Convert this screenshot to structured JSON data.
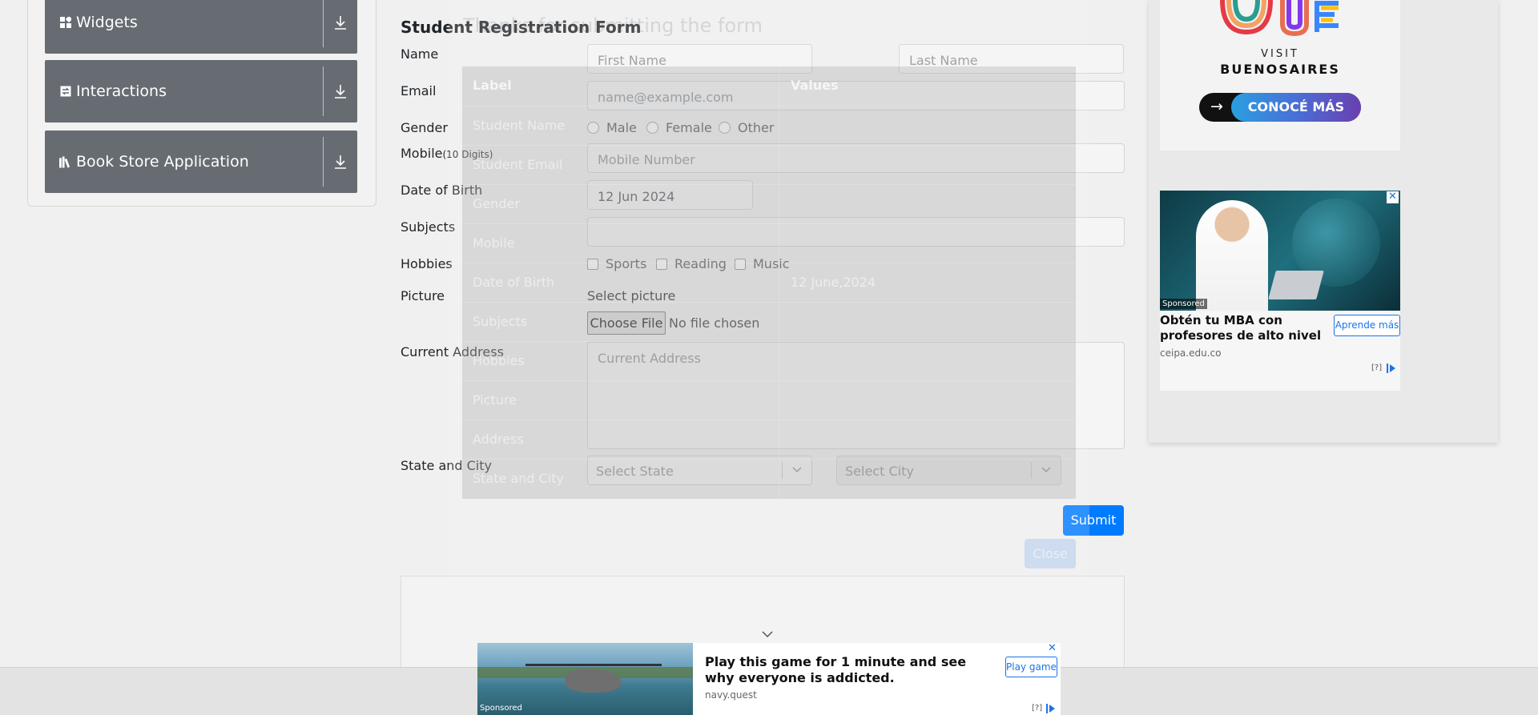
{
  "sidebar": {
    "groups": [
      {
        "label": "Widgets",
        "icon": "widgets-icon"
      },
      {
        "label": "Interactions",
        "icon": "interactions-icon"
      },
      {
        "label": "Book Store Application",
        "icon": "book-icon"
      }
    ]
  },
  "form": {
    "title": "Student Registration Form",
    "labels": {
      "name": "Name",
      "email": "Email",
      "gender": "Gender",
      "mobile": "Mobile",
      "mobile_hint": "(10 Digits)",
      "dob": "Date of Birth",
      "subjects": "Subjects",
      "hobbies": "Hobbies",
      "picture": "Picture",
      "address": "Current Address",
      "state_city": "State and City"
    },
    "first_name_placeholder": "First Name",
    "last_name_placeholder": "Last Name",
    "email_placeholder": "name@example.com",
    "gender_options": [
      "Male",
      "Female",
      "Other"
    ],
    "mobile_placeholder": "Mobile Number",
    "dob_value": "12 Jun 2024",
    "subjects_value": "",
    "hobbies_options": [
      "Sports",
      "Reading",
      "Music"
    ],
    "picture_label": "Select picture",
    "choose_file": "Choose File",
    "no_file": "No file chosen",
    "address_placeholder": "Current Address",
    "state_placeholder": "Select State",
    "city_placeholder": "Select City",
    "submit": "Submit"
  },
  "modal": {
    "title": "Thanks for submitting the form",
    "header": {
      "label": "Label",
      "values": "Values"
    },
    "rows": [
      {
        "label": "Student Name",
        "value": ""
      },
      {
        "label": "Student Email",
        "value": ""
      },
      {
        "label": "Gender",
        "value": ""
      },
      {
        "label": "Mobile",
        "value": ""
      },
      {
        "label": "Date of Birth",
        "value": "12 June,2024"
      },
      {
        "label": "Subjects",
        "value": ""
      },
      {
        "label": "Hobbies",
        "value": ""
      },
      {
        "label": "Picture",
        "value": ""
      },
      {
        "label": "Address",
        "value": ""
      },
      {
        "label": "State and City",
        "value": ""
      }
    ],
    "close": "Close"
  },
  "ads": {
    "buenos_aires": {
      "visit": "VISIT",
      "city": "BUENOSAIRES",
      "cta": "CONOCÉ MÁS",
      "arrow": "→"
    },
    "mba": {
      "sponsored": "Sponsored",
      "headline": "Obtén tu MBA con profesores de alto nivel",
      "site": "ceipa.edu.co",
      "cta": "Aprende más",
      "info": "[?]",
      "close": "✕"
    },
    "game": {
      "sponsored": "Sponsored",
      "headline": "Play this game for 1 minute and see why everyone is addicted.",
      "site": "navy.quest",
      "cta": "Play game",
      "info": "[?]",
      "close": "✕"
    }
  },
  "colors": {
    "sidebar_group": "#666c72",
    "submit": "#007bff",
    "ad_blue": "#1a73e8"
  }
}
